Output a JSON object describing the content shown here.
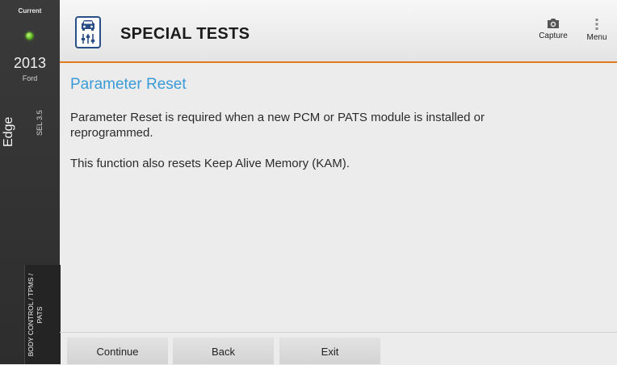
{
  "sidebar": {
    "status": "Current",
    "year": "2013",
    "make": "Ford",
    "model": "Edge",
    "trim": "SEL 3.5",
    "module": "BODY CONTROL / TPMS / PATS"
  },
  "header": {
    "title": "SPECIAL TESTS",
    "capture_label": "Capture",
    "menu_label": "Menu",
    "accent_color": "#e07b1e"
  },
  "main": {
    "title": "Parameter Reset",
    "paragraph1": "Parameter Reset is required when a new PCM or PATS module is installed or reprogrammed.",
    "paragraph2": "This function also resets Keep Alive Memory (KAM)."
  },
  "footer": {
    "continue_label": "Continue",
    "back_label": "Back",
    "exit_label": "Exit"
  }
}
